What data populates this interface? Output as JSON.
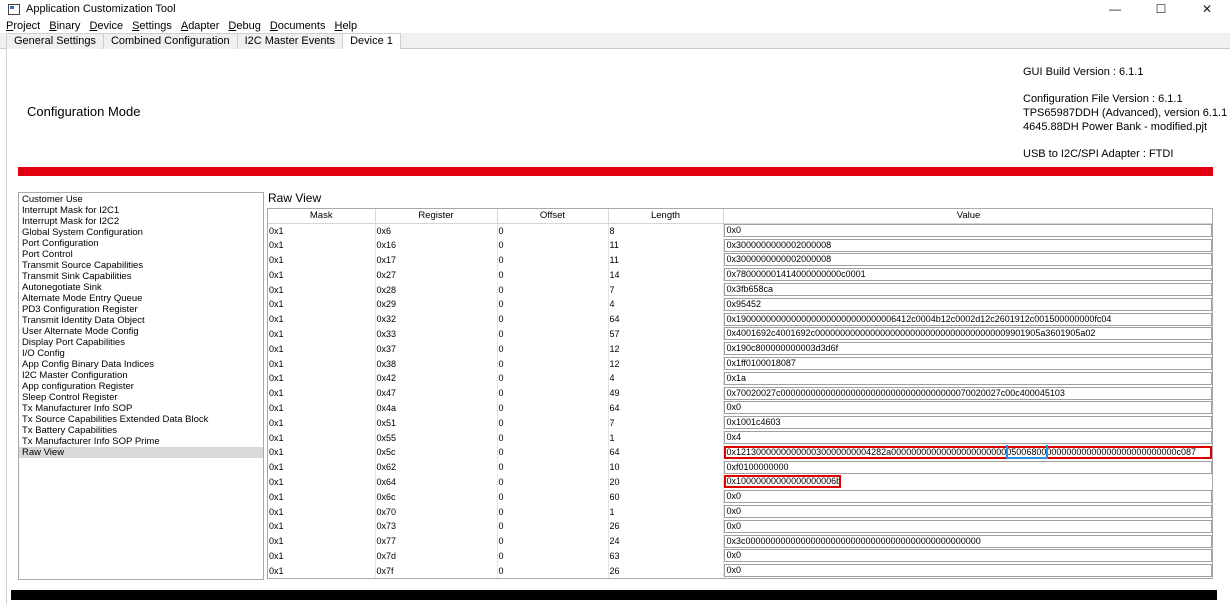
{
  "window": {
    "title": "Application Customization Tool",
    "controls": {
      "minimize": "—",
      "maximize": "☐",
      "close": "✕"
    }
  },
  "menu": [
    {
      "u": "P",
      "rest": "roject"
    },
    {
      "u": "B",
      "rest": "inary"
    },
    {
      "u": "D",
      "rest": "evice"
    },
    {
      "u": "S",
      "rest": "ettings"
    },
    {
      "u": "A",
      "rest": "dapter"
    },
    {
      "u": "D",
      "rest": "ebug"
    },
    {
      "u": "D",
      "rest": "ocuments"
    },
    {
      "u": "H",
      "rest": "elp"
    }
  ],
  "tabs": [
    "General Settings",
    "Combined Configuration",
    "I2C Master Events",
    "Device 1"
  ],
  "header": {
    "mode": "Configuration Mode",
    "gui_build": "GUI Build Version : 6.1.1",
    "config_file": "Configuration File Version : 6.1.1",
    "device": "TPS65987DDH (Advanced), version 6.1.1",
    "project": "4645.88DH Power Bank - modified.pjt",
    "adapter": "USB to I2C/SPI Adapter : FTDI"
  },
  "nav": [
    "Customer Use",
    "Interrupt Mask for I2C1",
    "Interrupt Mask for I2C2",
    "Global System Configuration",
    "Port Configuration",
    "Port Control",
    "Transmit Source Capabilities",
    "Transmit Sink Capabilities",
    "Autonegotiate Sink",
    "Alternate Mode Entry Queue",
    "PD3 Configuration Register",
    "Transmit Identity Data Object",
    "User Alternate Mode Config",
    "Display Port Capabilities",
    "I/O Config",
    "App Config Binary Data Indices",
    "I2C Master Configuration",
    "App configuration Register",
    "Sleep Control Register",
    "Tx Manufacturer Info SOP",
    "Tx Source Capabilities Extended Data Block",
    "Tx Battery Capabilities",
    "Tx Manufacturer Info SOP Prime",
    "Raw View"
  ],
  "raw": {
    "title": "Raw View",
    "columns": [
      "Mask",
      "Register",
      "Offset",
      "Length",
      "Value"
    ],
    "rows": [
      [
        "0x1",
        "0x6",
        "0",
        "8",
        "0x0"
      ],
      [
        "0x1",
        "0x16",
        "0",
        "11",
        "0x3000000000002000008"
      ],
      [
        "0x1",
        "0x17",
        "0",
        "11",
        "0x3000000000002000008"
      ],
      [
        "0x1",
        "0x27",
        "0",
        "14",
        "0x780000001414000000000c0001"
      ],
      [
        "0x1",
        "0x28",
        "0",
        "7",
        "0x3fb658ca"
      ],
      [
        "0x1",
        "0x29",
        "0",
        "4",
        "0x95452"
      ],
      [
        "0x1",
        "0x32",
        "0",
        "64",
        "0x19000000000000000000000000000006412c0004b12c0002d12c2601912c001500000000fc04"
      ],
      [
        "0x1",
        "0x33",
        "0",
        "57",
        "0x4001692c4001692c000000000000000000000000000000000000009901905a3601905a02"
      ],
      [
        "0x1",
        "0x37",
        "0",
        "12",
        "0x190c800000000003d3d6f"
      ],
      [
        "0x1",
        "0x38",
        "0",
        "12",
        "0x1ff0100018087"
      ],
      [
        "0x1",
        "0x42",
        "0",
        "4",
        "0x1a"
      ],
      [
        "0x1",
        "0x47",
        "0",
        "49",
        "0x70020027c00000000000000000000000000000000000070020027c00c400045103"
      ],
      [
        "0x1",
        "0x4a",
        "0",
        "64",
        "0x0"
      ],
      [
        "0x1",
        "0x51",
        "0",
        "7",
        "0x1001c4603"
      ],
      [
        "0x1",
        "0x55",
        "0",
        "1",
        "0x4"
      ],
      [
        "0x1",
        "0x5c",
        "0",
        "64",
        "0x121300000000000030000000004282a000000000000000000000000500680000000000000000000000000000c087"
      ],
      [
        "0x1",
        "0x62",
        "0",
        "10",
        "0xf0100000000"
      ],
      [
        "0x1",
        "0x64",
        "0",
        "20",
        "0x10000000000000000006b"
      ],
      [
        "0x1",
        "0x6c",
        "0",
        "60",
        "0x0"
      ],
      [
        "0x1",
        "0x70",
        "0",
        "1",
        "0x0"
      ],
      [
        "0x1",
        "0x73",
        "0",
        "26",
        "0x0"
      ],
      [
        "0x1",
        "0x77",
        "0",
        "24",
        "0x3c00000000000000000000000000000000000000000000000"
      ],
      [
        "0x1",
        "0x7d",
        "0",
        "63",
        "0x0"
      ],
      [
        "0x1",
        "0x7f",
        "0",
        "26",
        "0x0"
      ]
    ]
  }
}
